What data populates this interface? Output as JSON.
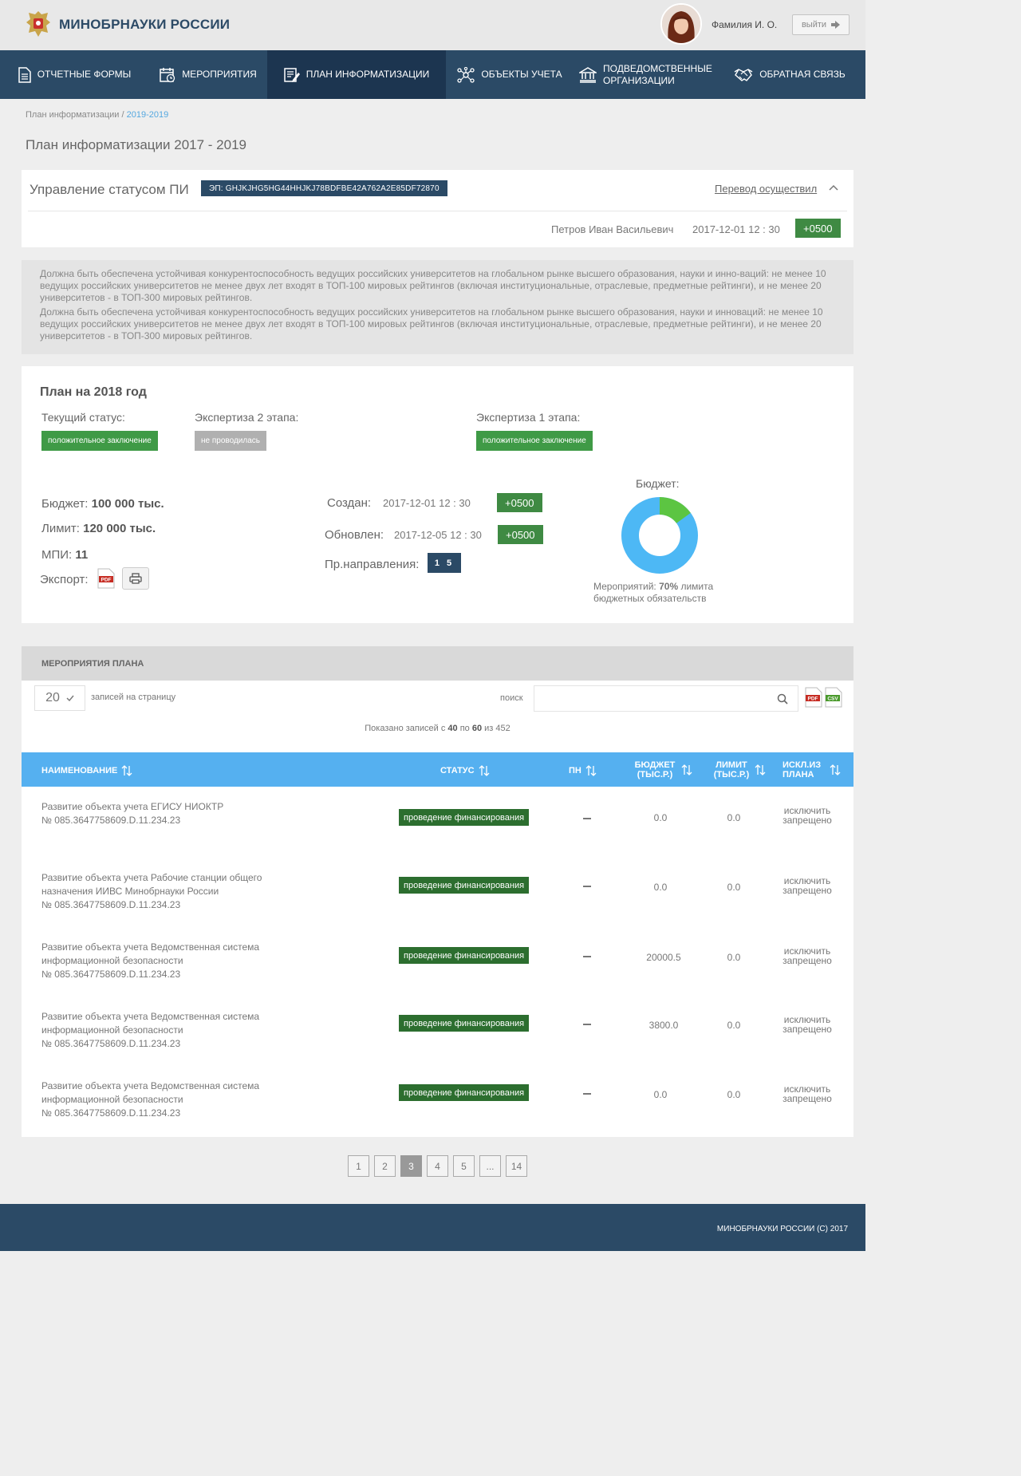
{
  "header": {
    "brand": "МИНОБРНАУКИ РОССИИ",
    "user_name": "Фамилия И. О.",
    "logout_label": "выйти"
  },
  "nav": {
    "items": [
      {
        "label": "ОТЧЕТНЫЕ ФОРМЫ",
        "icon": "document-icon"
      },
      {
        "label": "МЕРОПРИЯТИЯ",
        "icon": "calendar-clock-icon"
      },
      {
        "label": "ПЛАН ИНФОРМАТИЗАЦИИ",
        "icon": "plan-edit-icon"
      },
      {
        "label": "ОБЪЕКТЫ УЧЕТА",
        "icon": "network-icon"
      },
      {
        "label": "ПОДВЕДОМСТВЕННЫЕ ОРГАНИЗАЦИИ",
        "icon": "institution-icon"
      },
      {
        "label": "ОБРАТНАЯ СВЯЗЬ",
        "icon": "handshake-icon"
      }
    ],
    "active_index": 2
  },
  "breadcrumb": {
    "parent": "План информатизации",
    "separator": " / ",
    "current": "2019-2019"
  },
  "page_title": "План информатизации  2017 - 2019",
  "status_panel": {
    "title": "Управление статусом ПИ",
    "signature": "ЭП: GHJKJHG5HG44HHJKJ78BDFBE42A762A2E85DF72870",
    "transfer_link": "Перевод осуществил",
    "person": "Петров Иван Васильевич",
    "date": "2017-12-01  12 : 30",
    "tz": "+0500"
  },
  "description": [
    "Должна быть обеспечена устойчивая конкурентоспособность ведущих российских университетов на глобальном рынке высшего образования, науки и инно-ваций: не менее 10 ведущих российских университетов не менее двух лет входят в ТОП-100 мировых рейтингов (включая институциональные, отраслевые, предметные рейтинги), и не менее 20 университетов - в ТОП-300 мировых рейтингов.",
    "Должна быть обеспечена устойчивая конкурентоспособность ведущих российских университетов на глобальном рынке высшего образования, науки и инноваций: не менее 10 ведущих российских университетов не менее двух лет входят в ТОП-100 мировых рейтингов (включая институциональные, отраслевые, предметные рейтинги), и не менее 20 университетов - в ТОП-300 мировых рейтингов."
  ],
  "plan": {
    "title": "План на 2018 год",
    "current_status_label": "Текущий статус:",
    "current_status": "положительное заключение",
    "expertise2_label": "Экспертиза 2 этапа:",
    "expertise2": "не проводилась",
    "expertise1_label": "Экспертиза 1 этапа:",
    "expertise1": "положительное заключение",
    "budget_label": "Бюджет:",
    "budget": "100 000 тыс.",
    "limit_label": "Лимит:",
    "limit": "120 000 тыс.",
    "mpi_label": "МПИ:",
    "mpi": "11",
    "export_label": "Экспорт:",
    "pdf_label": "PDF",
    "created_label": "Создан:",
    "created": "2017-12-01   12 : 30",
    "created_tz": "+0500",
    "updated_label": "Обновлен:",
    "updated": "2017-12-05   12 : 30",
    "updated_tz": "+0500",
    "direction_label": "Пр.направления:",
    "direction": "1 5",
    "donut_title": "Бюджет:",
    "donut_share": 0.15,
    "donut_colors": {
      "main": "#4db8f5",
      "part": "#5cc542"
    },
    "caption_prefix": "Мероприятий: ",
    "caption_percent": "70%",
    "caption_rest": " лимита",
    "caption_line2": "бюджетных обязательств"
  },
  "events": {
    "title": "МЕРОПРИЯТИЯ ПЛАНА",
    "per_page": "20",
    "per_page_label": "записей на страницу",
    "search_label": "поиск",
    "search_value": "",
    "pdf_label": "PDF",
    "csv_label": "CSV",
    "shown_prefix": "Показано записей с ",
    "shown_from": "40",
    "shown_mid": " по ",
    "shown_to": "60",
    "shown_suffix": " из 452",
    "columns": {
      "name": "НАИМЕНОВАНИЕ",
      "status": "СТАТУС",
      "pn": "ПН",
      "budget": "БЮДЖЕТ (ТЫС.Р.)",
      "limit": "ЛИМИТ (ТЫС.Р.)",
      "exclude": "ИСКЛ.ИЗ ПЛАНА"
    },
    "rows": [
      {
        "name1": "Развитие объекта учета ЕГИСУ НИОКТР",
        "name2": "№ 085.3647758609.D.11.234.23",
        "name3": "",
        "status": "проведение финансирования",
        "budget": "0.0",
        "limit": "0.0",
        "exclude": "исключить запрещено"
      },
      {
        "name1": "Развитие объекта учета Рабочие станции общего",
        "name2": "назначения ИИВС Минобрнауки России",
        "name3": "№ 085.3647758609.D.11.234.23",
        "status": "проведение финансирования",
        "budget": "0.0",
        "limit": "0.0",
        "exclude": "исключить запрещено"
      },
      {
        "name1": "Развитие объекта учета Ведомственная система",
        "name2": "информационной безопасности",
        "name3": "№ 085.3647758609.D.11.234.23",
        "status": "проведение финансирования",
        "budget": "20000.5",
        "limit": "0.0",
        "exclude": "исключить запрещено"
      },
      {
        "name1": "Развитие объекта учета Ведомственная система",
        "name2": "информационной безопасности",
        "name3": "№ 085.3647758609.D.11.234.23",
        "status": "проведение финансирования",
        "budget": "3800.0",
        "limit": "0.0",
        "exclude": "исключить запрещено"
      },
      {
        "name1": "Развитие объекта учета Ведомственная система",
        "name2": "информационной безопасности",
        "name3": "№ 085.3647758609.D.11.234.23",
        "status": "проведение финансирования",
        "budget": "0.0",
        "limit": "0.0",
        "exclude": "исключить запрещено"
      }
    ]
  },
  "pagination": {
    "pages": [
      "1",
      "2",
      "3",
      "4",
      "5",
      "...",
      "14"
    ],
    "active": "3"
  },
  "footer": "МИНОБРНАУКИ РОССИИ  (С) 2017"
}
